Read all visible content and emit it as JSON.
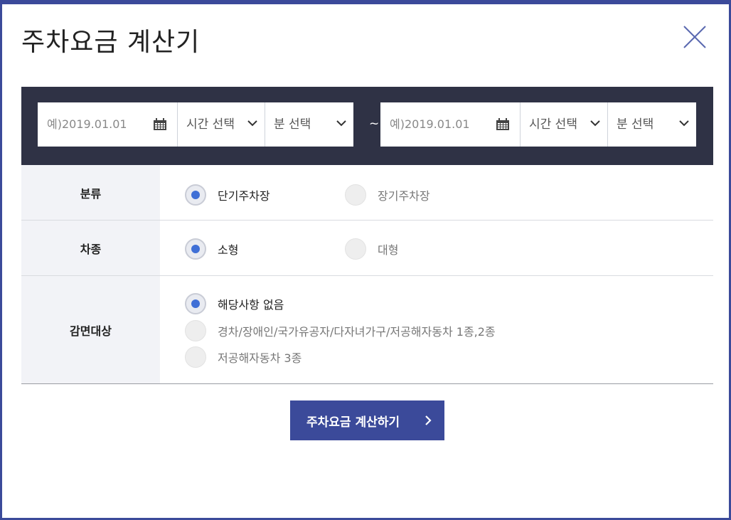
{
  "dialog": {
    "title": "주차요금 계산기"
  },
  "date_range": {
    "from": {
      "date_placeholder": "예)2019.01.01",
      "hour_select": "시간 선택",
      "minute_select": "분 선택"
    },
    "separator": "~",
    "to": {
      "date_placeholder": "예)2019.01.01",
      "hour_select": "시간 선택",
      "minute_select": "분 선택"
    }
  },
  "form": {
    "category": {
      "label": "분류",
      "options": [
        {
          "label": "단기주차장",
          "selected": true
        },
        {
          "label": "장기주차장",
          "selected": false
        }
      ]
    },
    "vehicle": {
      "label": "차종",
      "options": [
        {
          "label": "소형",
          "selected": true
        },
        {
          "label": "대형",
          "selected": false
        }
      ]
    },
    "discount": {
      "label": "감면대상",
      "options": [
        {
          "label": "해당사항 없음",
          "selected": true
        },
        {
          "label": "경차/장애인/국가유공자/다자녀가구/저공해자동차 1종,2종",
          "selected": false
        },
        {
          "label": "저공해자동차 3종",
          "selected": false
        }
      ]
    }
  },
  "submit": {
    "label": "주차요금 계산하기"
  },
  "colors": {
    "accent": "#3b4a9a",
    "date_bar": "#2f3245",
    "radio_selected": "#3f6fd6",
    "label_bg": "#f2f3f7"
  },
  "icons": {
    "close": "close-icon",
    "calendar": "calendar-icon",
    "dropdown": "chevron-down-icon",
    "submit_arrow": "chevron-right-icon"
  }
}
